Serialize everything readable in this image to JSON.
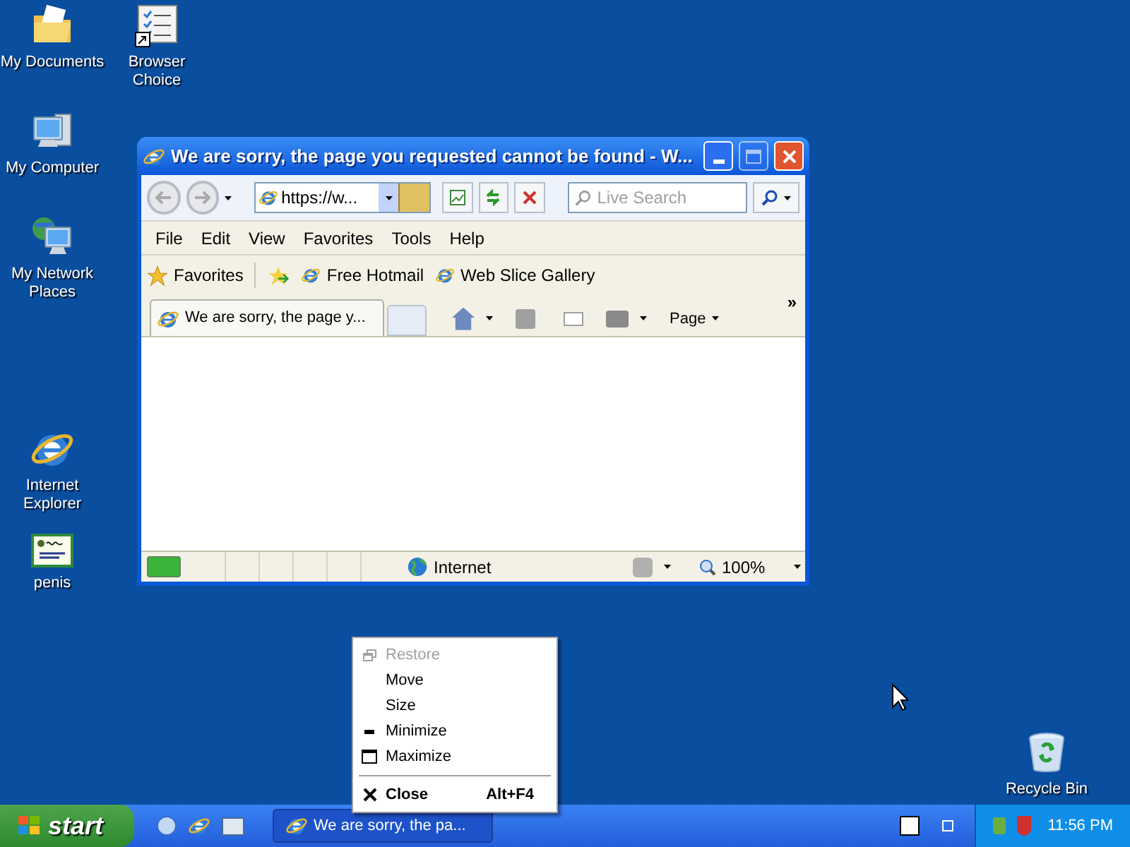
{
  "desktop_icons": [
    {
      "label": "My Documents",
      "kind": "documents"
    },
    {
      "label": "Browser Choice",
      "kind": "checklist"
    },
    {
      "label": "My Computer",
      "kind": "computer"
    },
    {
      "label": "My Network Places",
      "kind": "network"
    },
    {
      "label": "Internet Explorer",
      "kind": "ie"
    },
    {
      "label": "penis",
      "kind": "certificate"
    },
    {
      "label": "Recycle Bin",
      "kind": "recycle"
    }
  ],
  "window": {
    "title": "We are sorry, the page you requested cannot be found - W...",
    "address": "https://w...",
    "search": {
      "placeholder": "Live Search"
    },
    "menu": [
      "File",
      "Edit",
      "View",
      "Favorites",
      "Tools",
      "Help"
    ],
    "favorites_bar": {
      "label": "Favorites",
      "links": [
        "Free Hotmail",
        "Web Slice Gallery"
      ]
    },
    "tab": {
      "label": "We are sorry, the page y..."
    },
    "command_bar": {
      "page": "Page",
      "more": "»"
    },
    "status_bar": {
      "zone": "Internet",
      "zoom": "100%"
    }
  },
  "context_menu": [
    {
      "label": "Restore",
      "kind": "restore",
      "disabled": true,
      "default": false
    },
    {
      "label": "Move",
      "kind": "plain",
      "disabled": false,
      "default": false
    },
    {
      "label": "Size",
      "kind": "plain",
      "disabled": false,
      "default": false
    },
    {
      "label": "Minimize",
      "kind": "minimize",
      "disabled": false,
      "default": false
    },
    {
      "label": "Maximize",
      "kind": "maximize",
      "disabled": false,
      "default": false
    },
    {
      "kind": "separator"
    },
    {
      "label": "Close",
      "kind": "close",
      "disabled": false,
      "default": true,
      "shortcut": "Alt+F4"
    }
  ],
  "taskbar": {
    "start": "start",
    "task": "We are sorry, the pa...",
    "clock": "11:56 PM"
  }
}
